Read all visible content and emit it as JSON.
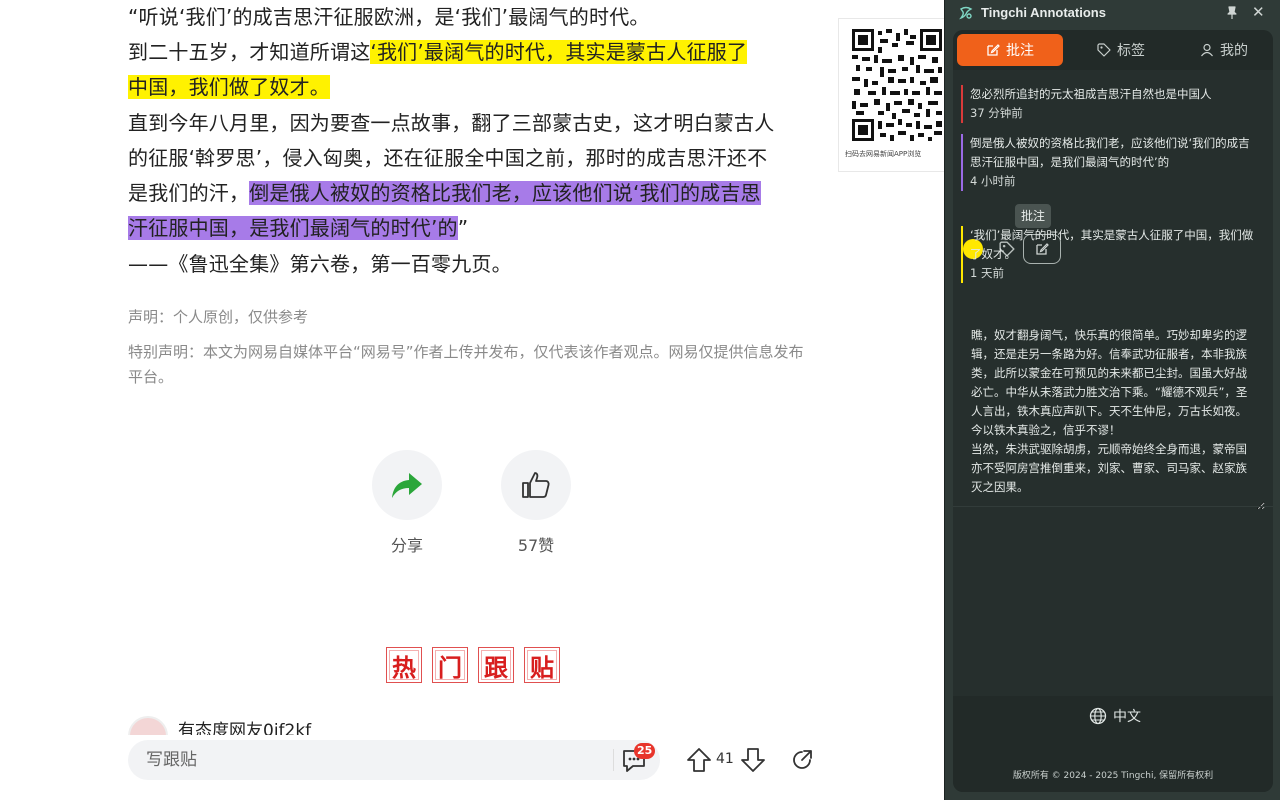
{
  "article": {
    "line1": "“听说‘我们’的成吉思汗征服欧洲，是‘我们’最阔气的时代。",
    "p2_plain": "到二十五岁，才知道所谓这",
    "p2_highlight_a": "‘我们’最阔气的时代，其实是蒙古人征服了",
    "p2_highlight_b": "中国，我们做了奴才。",
    "p3_line1": "直到今年八月里，因为要查一点故事，翻了三部蒙古史，这才明白蒙古人",
    "p3_line2": "的征服‘斡罗思’，侵入匈奥，还在征服全中国之前，那时的成吉思汗还不",
    "p3_line3_plain": "是我们的汗，",
    "p3_line3_highlight": "倒是俄人被奴的资格比我们老，应该他们说‘我们的成吉思",
    "p3_line4_highlight": "汗征服中国，是我们最阔气的时代’的",
    "p3_line4_end": "”",
    "source": "——《鲁迅全集》第六卷，第一百零九页。",
    "statement": "声明：个人原创，仅供参考",
    "special_statement": "特别声明：本文为网易自媒体平台“网易号”作者上传并发布，仅代表该作者观点。网易仅提供信息发布平台。"
  },
  "qr": {
    "caption": "扫码去网易新闻APP浏览"
  },
  "actions": {
    "share_label": "分享",
    "like_label": "57赞"
  },
  "hot": {
    "chars": [
      "热",
      "门",
      "跟",
      "贴"
    ]
  },
  "commenter": {
    "name": "有态度网友0jf2kf"
  },
  "bottom_bar": {
    "reply_placeholder": "写跟贴",
    "comment_count": "25",
    "vote_count": "41"
  },
  "panel": {
    "title": "Tingchi Annotations",
    "tabs": {
      "annotate": "批注",
      "tags": "标签",
      "mine": "我的"
    },
    "annotations": [
      {
        "text": "忽必烈所追封的元太祖成吉思汗自然也是中国人",
        "time": "37 分钟前",
        "color": "#d93a3a"
      },
      {
        "text": "倒是俄人被奴的资格比我们老，应该他们说‘我们的成吉思汗征服中国，是我们最阔气的时代’的",
        "time": "4 小时前",
        "color": "#9b6ae6"
      },
      {
        "text": "‘我们’最阔气的时代，其实是蒙古人征服了中国，我们做了奴才。",
        "time": "1 天前",
        "color": "#ffe800"
      }
    ],
    "tooltip": "批注",
    "note_value": "瞧，奴才翻身阔气，快乐真的很简单。巧妙却卑劣的逻辑，还是走另一条路为好。信奉武功征服者，本非我族类，此所以蒙金在可预见的未来都已尘封。国虽大好战必亡。中华从未落武力胜文治下乘。“耀德不观兵”，圣人言出，铁木真应声趴下。天不生仲尼，万古长如夜。今以铁木真验之，信乎不谬！\n当然，朱洪武驱除胡虏，元顺帝始终全身而退，蒙帝国亦不受阿房宫推倒重来，刘家、曹家、司马家、赵家族灭之因果。",
    "language": "中文",
    "copyright": "版权所有 © 2024 - 2025 Tingchi, 保留所有权利",
    "swatch_color": "#ffe800",
    "accent_color": "#f0611a"
  }
}
